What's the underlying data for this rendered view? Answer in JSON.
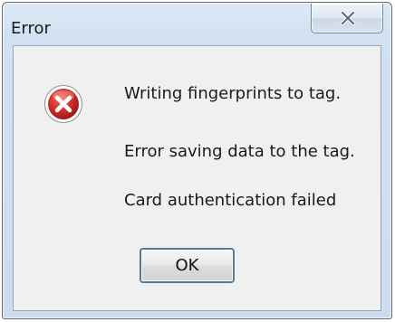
{
  "window": {
    "title": "Error",
    "close_icon": "close-x-icon"
  },
  "dialog": {
    "icon": "error-icon",
    "messages": [
      "Writing fingerprints to tag.",
      "Error saving data to the tag.",
      "Card authentication failed"
    ],
    "ok_label": "OK"
  },
  "colors": {
    "error_red": "#c4271f",
    "frame": "#cddcee",
    "client_bg": "#f0f0f0"
  }
}
